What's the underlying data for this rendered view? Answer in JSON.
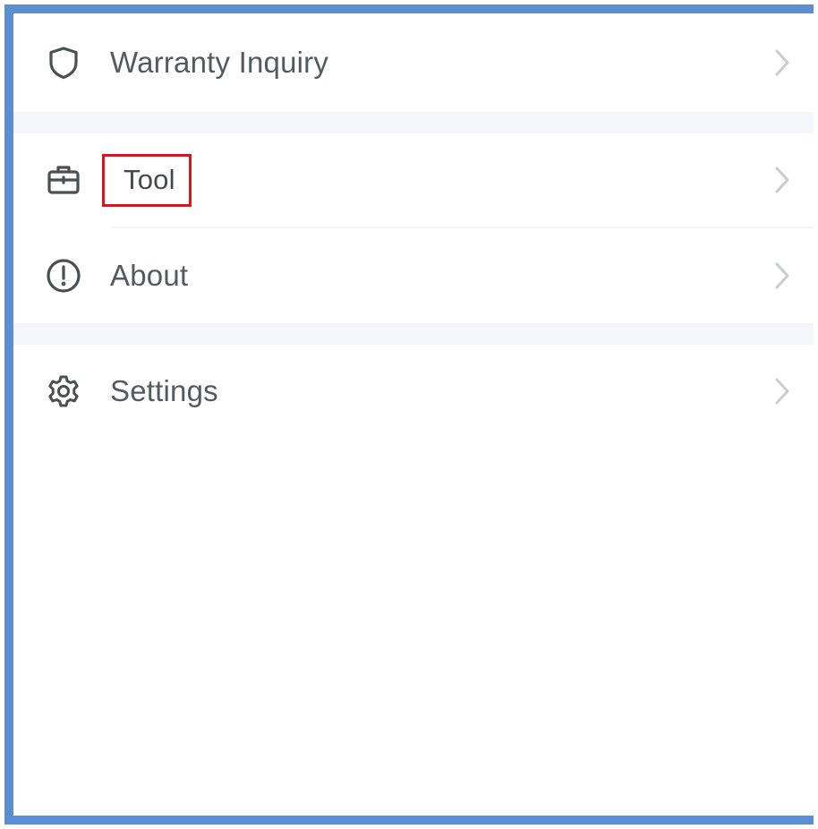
{
  "menu": {
    "items": [
      {
        "id": "warranty",
        "label": "Warranty Inquiry",
        "icon": "shield-icon"
      },
      {
        "id": "tool",
        "label": "Tool",
        "icon": "toolbox-icon",
        "highlighted": true
      },
      {
        "id": "about",
        "label": "About",
        "icon": "info-circle-icon"
      },
      {
        "id": "settings",
        "label": "Settings",
        "icon": "gear-icon"
      }
    ]
  },
  "colors": {
    "frame_border": "#5b8ed2",
    "highlight_box": "#d9151b",
    "separator": "#f4f6fb",
    "text": "#555a61",
    "icon": "#4a4e55",
    "chevron": "#c9ccd1"
  }
}
